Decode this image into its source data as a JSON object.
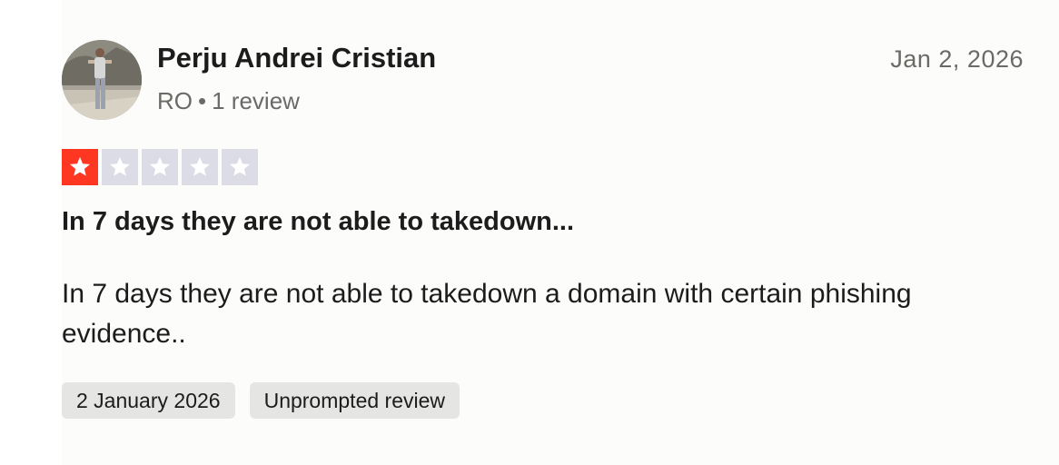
{
  "review": {
    "author": {
      "name": "Perju Andrei Cristian",
      "country": "RO",
      "separator": "•",
      "review_count": "1 review"
    },
    "date_short": "Jan 2, 2026",
    "rating": {
      "value": 1,
      "max": 5
    },
    "title": "In 7 days they are not able to takedown...",
    "body": "In 7 days they are not able to takedown a domain with certain phishing evidence..",
    "tags": {
      "date_long": "2 January 2026",
      "source": "Unprompted review"
    },
    "colors": {
      "star_filled": "#ff3722",
      "star_empty": "#dcdce6",
      "tag_bg": "#e5e5e3"
    }
  }
}
